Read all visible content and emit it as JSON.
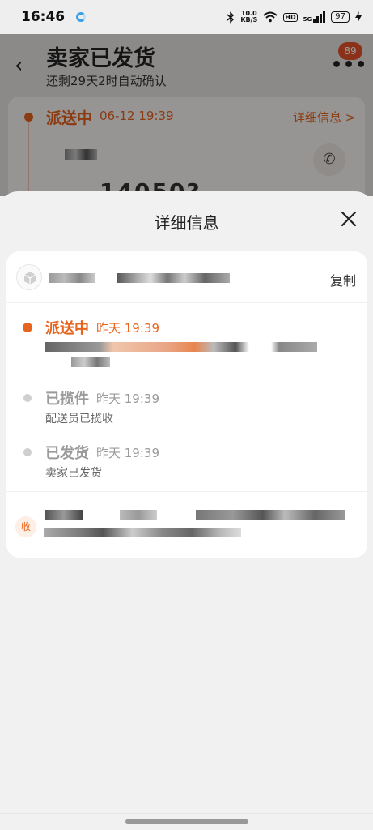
{
  "status_bar": {
    "time": "16:46",
    "net_speed_top": "10.0",
    "net_speed_bottom": "KB/S",
    "hd": "HD",
    "signal_label": "5G",
    "battery": "97"
  },
  "background_page": {
    "title": "卖家已发货",
    "subtitle": "还剩29天2时自动确认",
    "message_badge": "89",
    "card_status": "派送中",
    "card_time": "06-12 19:39",
    "card_detail_link": "详细信息 >",
    "card_number_partial": "14050?"
  },
  "sheet": {
    "title": "详细信息",
    "copy_label": "复制",
    "events": [
      {
        "status": "派送中",
        "time": "昨天 19:39",
        "desc": ""
      },
      {
        "status": "已揽件",
        "time": "昨天 19:39",
        "desc": "配送员已揽收"
      },
      {
        "status": "已发货",
        "time": "昨天 19:39",
        "desc": "卖家已发货"
      }
    ],
    "receiver_badge": "收"
  },
  "colors": {
    "accent": "#e8631e",
    "inactive": "#9a9a9a"
  },
  "icons": [
    "back-icon",
    "more-icon",
    "phone-icon",
    "close-icon",
    "package-icon",
    "bluetooth-icon",
    "wifi-icon",
    "battery-icon"
  ]
}
